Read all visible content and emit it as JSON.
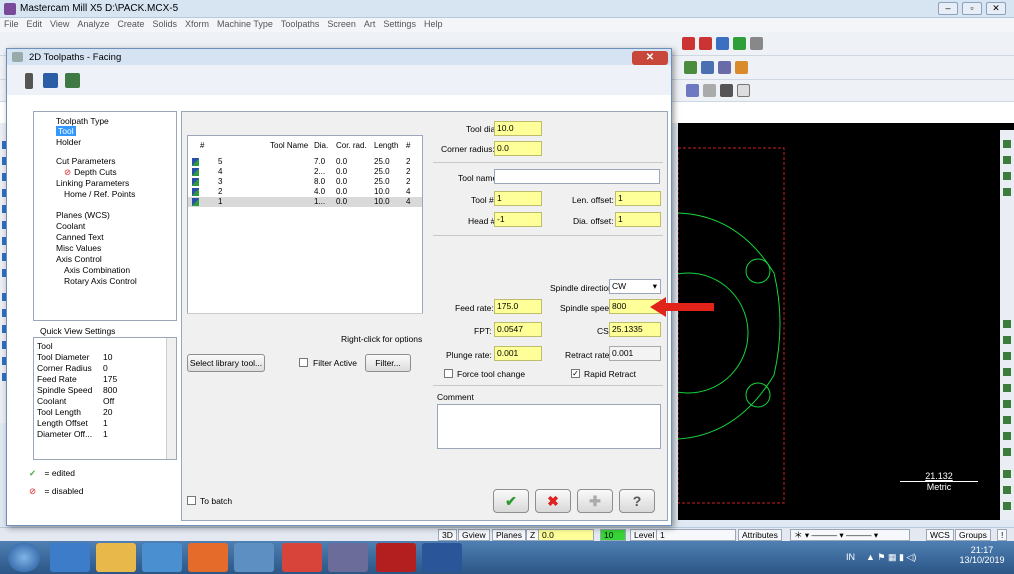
{
  "app": {
    "title": "Mastercam Mill X5  D:\\PACK.MCX-5",
    "menu": [
      "File",
      "Edit",
      "View",
      "Analyze",
      "Create",
      "Solids",
      "Xform",
      "Machine Type",
      "Toolpaths",
      "Screen",
      "Art",
      "Settings",
      "Help"
    ]
  },
  "dialog": {
    "title": "2D Toolpaths - Facing",
    "tree": [
      {
        "label": "Toolpath Type"
      },
      {
        "label": "Tool",
        "selected": true
      },
      {
        "label": "Holder"
      },
      {
        "label": "Cut Parameters"
      },
      {
        "label": "Depth Cuts"
      },
      {
        "label": "Linking Parameters"
      },
      {
        "label": "Home / Ref. Points"
      },
      {
        "label": "Planes (WCS)"
      },
      {
        "label": "Coolant"
      },
      {
        "label": "Canned Text"
      },
      {
        "label": "Misc Values"
      },
      {
        "label": "Axis Control"
      },
      {
        "label": "Axis Combination"
      },
      {
        "label": "Rotary Axis Control"
      }
    ],
    "quick_view": {
      "label": "Quick View Settings",
      "rows": [
        {
          "k": "Tool",
          "v": ""
        },
        {
          "k": "Tool Diameter",
          "v": "10"
        },
        {
          "k": "Corner Radius",
          "v": "0"
        },
        {
          "k": "Feed Rate",
          "v": "175"
        },
        {
          "k": "Spindle Speed",
          "v": "800"
        },
        {
          "k": "Coolant",
          "v": "Off"
        },
        {
          "k": "Tool Length",
          "v": "20"
        },
        {
          "k": "Length Offset",
          "v": "1"
        },
        {
          "k": "Diameter Off...",
          "v": "1"
        }
      ]
    },
    "legend": {
      "edited": "= edited",
      "disabled": "= disabled"
    },
    "tool_table": {
      "headers": [
        "#",
        "Tool Name",
        "Dia.",
        "Cor. rad.",
        "Length",
        "#"
      ],
      "rows": [
        {
          "n": "5",
          "name": "",
          "dia": "7.0",
          "cor": "0.0",
          "len": "25.0",
          "f": "2"
        },
        {
          "n": "4",
          "name": "",
          "dia": "2...",
          "cor": "0.0",
          "len": "25.0",
          "f": "2"
        },
        {
          "n": "3",
          "name": "",
          "dia": "8.0",
          "cor": "0.0",
          "len": "25.0",
          "f": "2"
        },
        {
          "n": "2",
          "name": "",
          "dia": "4.0",
          "cor": "0.0",
          "len": "10.0",
          "f": "4"
        },
        {
          "n": "1",
          "name": "",
          "dia": "1...",
          "cor": "0.0",
          "len": "10.0",
          "f": "4"
        }
      ],
      "hint": "Right-click for options"
    },
    "buttons": {
      "select_library": "Select library tool...",
      "filter_active": "Filter Active",
      "filter": "Filter...",
      "to_batch": "To batch"
    },
    "params": {
      "tool_dia_label": "Tool dia:",
      "tool_dia": "10.0",
      "corner_radius_label": "Corner radius:",
      "corner_radius": "0.0",
      "tool_name_label": "Tool name:",
      "tool_name": "",
      "tool_no_label": "Tool #:",
      "tool_no": "1",
      "len_offset_label": "Len. offset:",
      "len_offset": "1",
      "head_label": "Head #:",
      "head": "-1",
      "dia_offset_label": "Dia. offset:",
      "dia_offset": "1",
      "spindle_dir_label": "Spindle direction:",
      "spindle_dir": "CW",
      "feed_rate_label": "Feed rate:",
      "feed_rate": "175.0",
      "spindle_speed_label": "Spindle speed:",
      "spindle_speed": "800",
      "fpt_label": "FPT:",
      "fpt": "0.0547",
      "cs_label": "CS",
      "cs": "25.1335",
      "plunge_label": "Plunge rate:",
      "plunge": "0.001",
      "retract_label": "Retract rate:",
      "retract": "0.001",
      "force_tool_change": "Force tool change",
      "rapid_retract": "Rapid Retract",
      "comment_label": "Comment"
    }
  },
  "status": {
    "b3d": "3D",
    "gview": "Gview",
    "planes": "Planes",
    "z": "Z",
    "zval": "0.0",
    "level_num": "10",
    "level": "Level",
    "level_val": "1",
    "attributes": "Attributes",
    "wcs": "WCS",
    "groups": "Groups"
  },
  "graphics": {
    "scale_value": "21.132",
    "scale_unit": "Metric"
  },
  "taskbar": {
    "lang": "IN",
    "time": "21:17",
    "date": "13/10/2019"
  },
  "colors": {
    "highlight": "#ffff99",
    "arrow": "#e2231a",
    "geometry": "#17d43a",
    "selected": "#3399ff"
  }
}
